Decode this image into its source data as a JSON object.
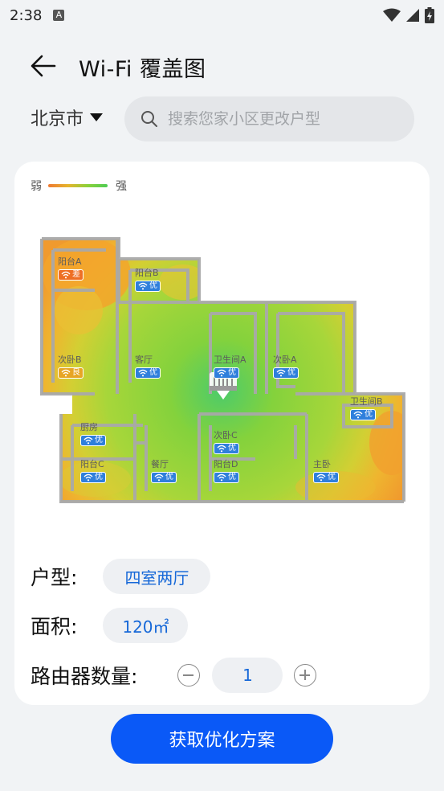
{
  "status_bar": {
    "time": "2:38",
    "notification_icon_label": "A"
  },
  "app_bar": {
    "title": "Wi-Fi 覆盖图"
  },
  "location": {
    "city": "北京市"
  },
  "search": {
    "placeholder": "搜索您家小区更改户型"
  },
  "legend": {
    "weak": "弱",
    "strong": "强"
  },
  "colors": {
    "primary": "#0a59f7",
    "good_badge": "#2f7fdc",
    "fair_badge": "#e7a524",
    "poor_badge": "#ee6f24",
    "signal_strong": "#4dcc54",
    "signal_weak": "#ee7a33"
  },
  "rooms": [
    {
      "name": "阳台A",
      "signal": "差",
      "level": "poor"
    },
    {
      "name": "阳台B",
      "signal": "优",
      "level": "good"
    },
    {
      "name": "次卧B",
      "signal": "良",
      "level": "fair"
    },
    {
      "name": "客厅",
      "signal": "优",
      "level": "good"
    },
    {
      "name": "卫生间A",
      "signal": "优",
      "level": "good"
    },
    {
      "name": "次卧A",
      "signal": "优",
      "level": "good"
    },
    {
      "name": "卫生间B",
      "signal": "优",
      "level": "good"
    },
    {
      "name": "厨房",
      "signal": "优",
      "level": "good"
    },
    {
      "name": "次卧C",
      "signal": "优",
      "level": "good"
    },
    {
      "name": "阳台C",
      "signal": "优",
      "level": "good"
    },
    {
      "name": "餐厅",
      "signal": "优",
      "level": "good"
    },
    {
      "name": "阳台D",
      "signal": "优",
      "level": "good"
    },
    {
      "name": "主卧",
      "signal": "优",
      "level": "good"
    }
  ],
  "details": {
    "layout_label": "户型:",
    "layout_value": "四室两厅",
    "area_label": "面积:",
    "area_value": "120㎡",
    "router_label": "路由器数量:",
    "router_count": "1"
  },
  "actions": {
    "optimize_label": "获取优化方案"
  }
}
